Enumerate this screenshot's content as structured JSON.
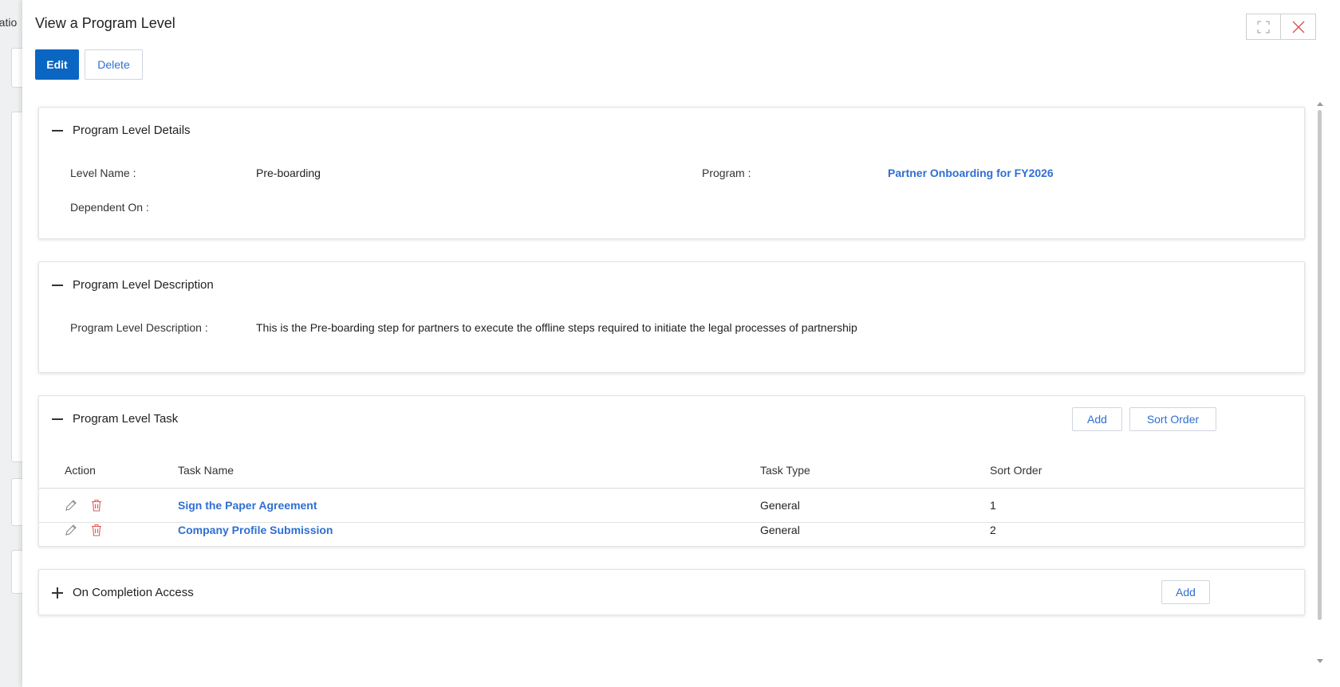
{
  "background": {
    "partial_text": "ratio"
  },
  "modal": {
    "title": "View a Program Level",
    "buttons": {
      "edit": "Edit",
      "delete": "Delete"
    }
  },
  "details": {
    "title": "Program Level Details",
    "level_name_label": "Level Name :",
    "level_name_value": "Pre-boarding",
    "program_label": "Program :",
    "program_value": "Partner Onboarding for FY2026",
    "dependent_on_label": "Dependent On :",
    "dependent_on_value": ""
  },
  "description": {
    "title": "Program Level Description",
    "label": "Program Level Description :",
    "value": "This is the Pre-boarding step for partners to execute the offline steps required to initiate the legal processes of partnership"
  },
  "tasks": {
    "title": "Program Level Task",
    "add_label": "Add",
    "sort_order_label": "Sort Order",
    "columns": [
      "Action",
      "Task Name",
      "Task Type",
      "Sort Order"
    ],
    "rows": [
      {
        "task_name": "Sign the Paper Agreement",
        "task_type": "General",
        "sort_order": "1"
      },
      {
        "task_name": "Company Profile Submission",
        "task_type": "General",
        "sort_order": "2"
      }
    ]
  },
  "completion": {
    "title": "On Completion Access",
    "add_label": "Add"
  },
  "colors": {
    "primary": "#0a66c2",
    "link": "#2f6fd1",
    "delete_icon": "#e05a5a",
    "close_icon": "#d9534f"
  },
  "icons": [
    "maximize-icon",
    "close-icon",
    "pencil-icon",
    "trash-icon",
    "collapse-icon",
    "expand-icon"
  ]
}
